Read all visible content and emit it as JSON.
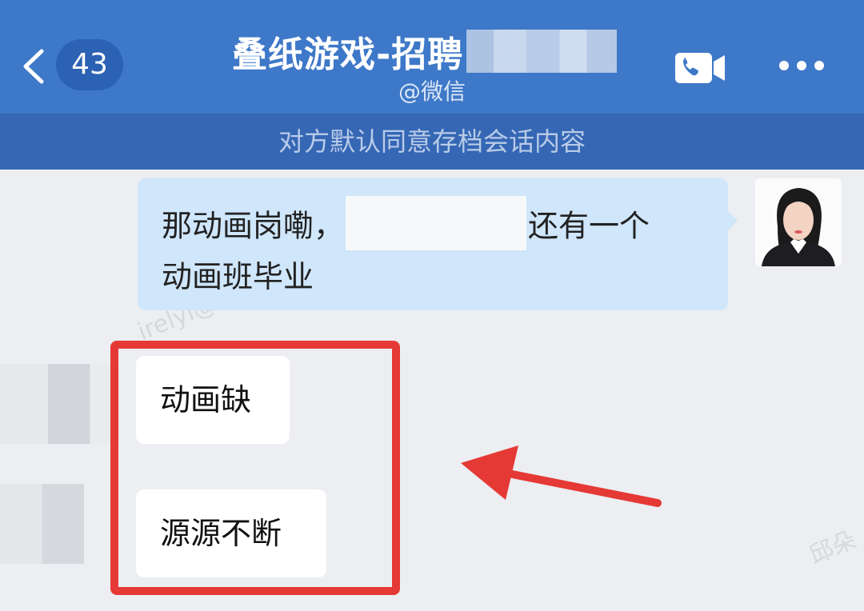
{
  "header": {
    "unread_count": "43",
    "title": "叠纸游戏-招聘",
    "subtitle": "@微信",
    "colors": {
      "background": "#3e78c8",
      "badge": "#2b62b3"
    }
  },
  "notice": {
    "text": "对方默认同意存档会话内容"
  },
  "messages": [
    {
      "side": "right",
      "text_part1": "那动画岗嘞，",
      "text_part2": "还有一个",
      "text_part3": "动画班毕业"
    },
    {
      "side": "left",
      "text": "动画缺"
    },
    {
      "side": "left",
      "text": "源源不断"
    }
  ],
  "watermarks": [
    "irelyi@",
    "邱朵"
  ],
  "icons": [
    "back-chevron-icon",
    "video-call-icon",
    "more-icon",
    "red-arrow-icon"
  ],
  "highlight_color": "#e53935"
}
